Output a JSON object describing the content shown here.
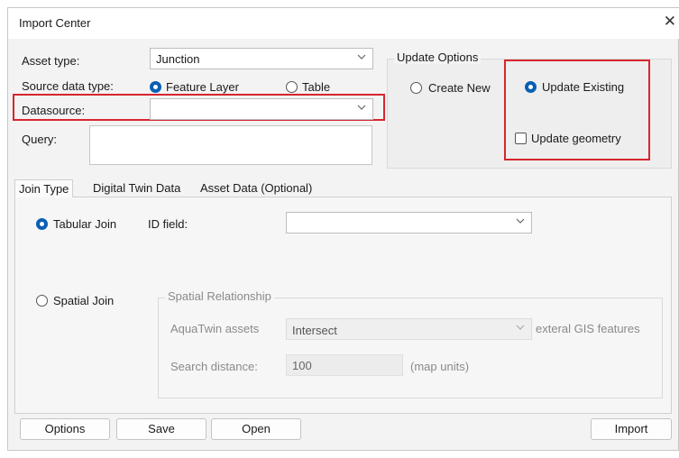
{
  "window": {
    "title": "Import Center",
    "close_glyph": "✕"
  },
  "fields": {
    "asset_type": {
      "label": "Asset type:",
      "value": "Junction"
    },
    "source_data_type": {
      "label": "Source data type:",
      "option_feature_layer": "Feature Layer",
      "option_table": "Table",
      "selected": "Feature Layer"
    },
    "datasource": {
      "label": "Datasource:",
      "value": ""
    },
    "query": {
      "label": "Query:",
      "value": ""
    }
  },
  "update_options": {
    "legend": "Update Options",
    "create_new": "Create New",
    "update_existing": "Update Existing",
    "selected": "Update Existing",
    "update_geometry": {
      "label": "Update geometry",
      "checked": false
    }
  },
  "tabs": [
    {
      "label": "Join Type",
      "active": true
    },
    {
      "label": "Digital Twin Data",
      "active": false
    },
    {
      "label": "Asset Data (Optional)",
      "active": false
    }
  ],
  "join": {
    "tabular_join": "Tabular Join",
    "spatial_join": "Spatial Join",
    "selected": "Tabular Join",
    "id_field": {
      "label": "ID field:",
      "value": ""
    },
    "spatial_relationship": {
      "legend": "Spatial Relationship",
      "assets_label": "AquaTwin assets",
      "relation_value": "Intersect",
      "features_label": "exteral GIS features",
      "search_distance_label": "Search distance:",
      "search_distance_value": "100",
      "units": "(map units)"
    }
  },
  "buttons": {
    "options": "Options",
    "save": "Save",
    "open": "Open",
    "import": "Import"
  },
  "colors": {
    "accent": "#0a5fb4",
    "highlight": "#d7262e"
  },
  "icons": {
    "close": "close-icon",
    "chevron": "chevron-down-icon"
  }
}
